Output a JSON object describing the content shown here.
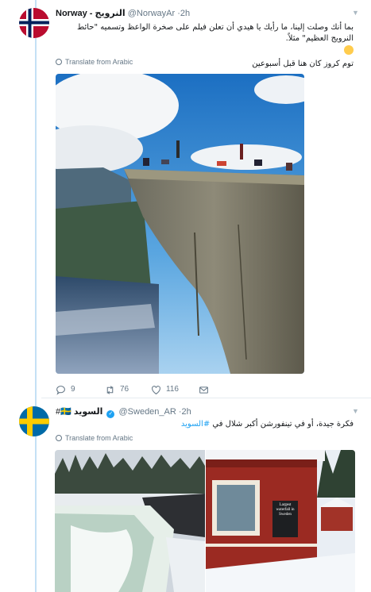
{
  "tweets": [
    {
      "display_name": "Norway - النرويج",
      "handle": "@NorwayAr",
      "time": "·2h",
      "text_line1": "بما أنك وصلت إلينا، ما رأيك يا هيدي أن تعلن فيلم على صخرة الواعظ وتسميه \"حائط النرويج العظيم\" مثلاً.",
      "text_line2": "توم كروز كان هنا قبل أسبوعين",
      "translate": "Translate from Arabic",
      "stats": {
        "replies": "9",
        "retweets": "76",
        "likes": "116"
      },
      "photo_alt": "Preikestolen cliff"
    },
    {
      "display_name": "السويد",
      "flag_tag": "#🇸🇪",
      "handle": "@Sweden_AR",
      "time": "·2h",
      "text_prefix": "فكرة جيدة، أو في تينفورشن أكبر شلال في ",
      "hashtag": "#السويد",
      "translate": "Translate from Arabic",
      "sign_text": "Largest waterfall in Sweden"
    }
  ],
  "colors": {
    "accent": "#1da1f2",
    "thread_line": "#c4e0f5",
    "muted": "#657786",
    "reply_icon": "#657786",
    "retweet_icon": "#657786",
    "like_icon": "#657786"
  },
  "icons": [
    "norway-flag-avatar",
    "sweden-flag-avatar",
    "globe-icon",
    "reply-icon",
    "retweet-icon",
    "like-icon",
    "direct-message-icon",
    "chevron-down-icon",
    "verified-icon",
    "thinking-face-emoji"
  ]
}
